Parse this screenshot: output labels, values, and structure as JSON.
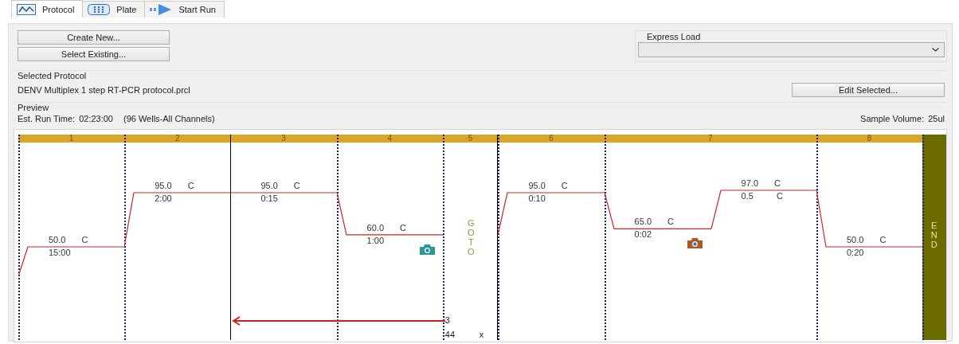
{
  "tabs": [
    {
      "label": "Protocol",
      "selected": true,
      "kind": "wave"
    },
    {
      "label": "Plate",
      "selected": false,
      "kind": "plate"
    },
    {
      "label": "Start Run",
      "selected": false,
      "kind": "run"
    }
  ],
  "buttons": [
    "Create New...",
    "Select Existing..."
  ],
  "express_load": {
    "label": "Express Load"
  },
  "selected_protocol": {
    "label": "Selected Protocol",
    "name": "DENV Multiplex  1 step RT-PCR protocol.prcl",
    "edit_button": "Edit Selected..."
  },
  "preview": {
    "label": "Preview",
    "run_time_label": "Est. Run Time:",
    "run_time": "02:23:00",
    "wells": "(96 Wells-All Channels)",
    "sample_volume_label": "Sample Volume:",
    "sample_volume": "25ul"
  },
  "protocol_steps": [
    {
      "kind": "step",
      "number": "1",
      "loop_start": false,
      "segments": [
        {
          "temp": "50.0",
          "unit": "C",
          "time": "15:00"
        }
      ]
    },
    {
      "kind": "step",
      "number": "2",
      "loop_start": false,
      "segments": [
        {
          "temp": "95.0",
          "unit": "C",
          "time": "2:00"
        }
      ]
    },
    {
      "kind": "step",
      "number": "3",
      "loop_start": true,
      "segments": [
        {
          "temp": "95.0",
          "unit": "C",
          "time": "0:15"
        }
      ]
    },
    {
      "kind": "step",
      "number": "4",
      "loop_start": false,
      "segments": [
        {
          "temp": "60.0",
          "unit": "C",
          "time": "1:00",
          "camera": {
            "color": "#2a9a8c"
          }
        }
      ]
    },
    {
      "kind": "goto",
      "number": "5",
      "label": "GOTO",
      "target": "3",
      "cycles": "44",
      "times": "x"
    },
    {
      "kind": "step",
      "number": "6",
      "loop_start": false,
      "segments": [
        {
          "temp": "95.0",
          "unit": "C",
          "time": "0:10"
        }
      ]
    },
    {
      "kind": "step",
      "number": "7",
      "loop_start": false,
      "segments": [
        {
          "temp": "65.0",
          "unit": "C",
          "time": "0:02",
          "camera": {
            "color": "#b5541c"
          }
        },
        {
          "temp": "97.0",
          "unit": "C",
          "time": "0.5",
          "time_unit": "C"
        }
      ]
    },
    {
      "kind": "step",
      "number": "8",
      "loop_start": false,
      "segments": [
        {
          "temp": "50.0",
          "unit": "C",
          "time": "0:20"
        }
      ]
    },
    {
      "kind": "end",
      "label": "END"
    }
  ]
}
